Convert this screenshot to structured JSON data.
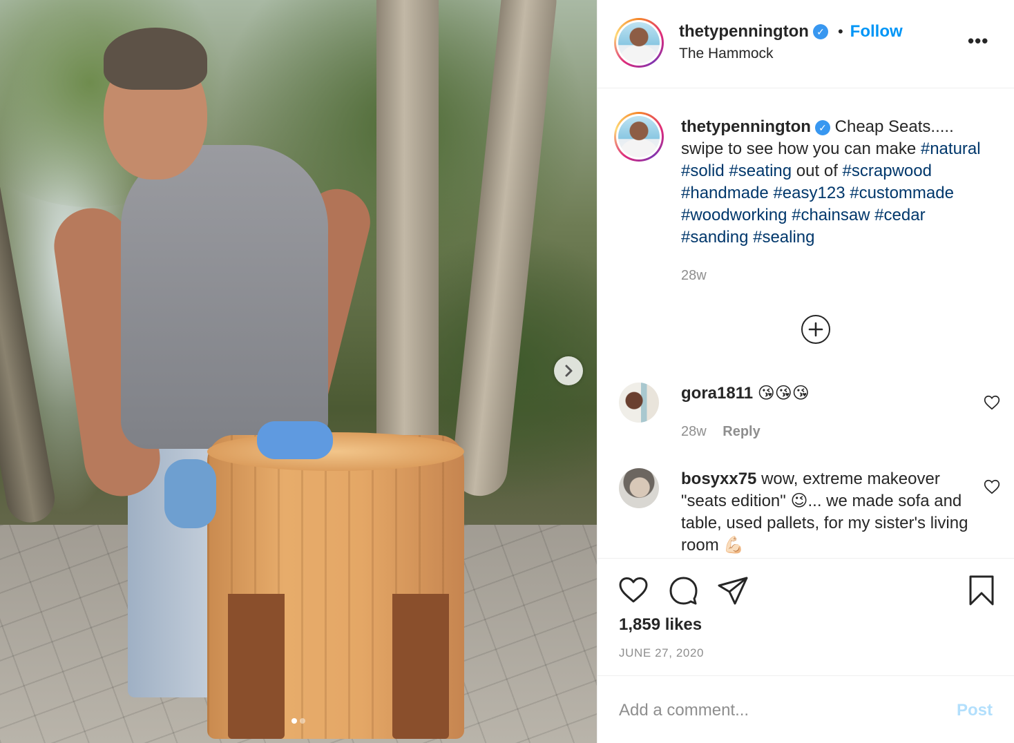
{
  "post": {
    "image_alt": "Man in gray tank top and blue gloves leaning on a handmade cedar stool outdoors",
    "carousel": {
      "count": 2,
      "active_index": 0
    }
  },
  "header": {
    "username": "thetypennington",
    "separator": "•",
    "follow_label": "Follow",
    "location": "The Hammock"
  },
  "caption": {
    "username": "thetypennington",
    "segments": [
      {
        "text": "Cheap Seats..... swipe to see how you can make ",
        "tag": false
      },
      {
        "text": "#natural",
        "tag": true
      },
      {
        "text": " ",
        "tag": false
      },
      {
        "text": "#solid",
        "tag": true
      },
      {
        "text": " ",
        "tag": false
      },
      {
        "text": "#seating",
        "tag": true
      },
      {
        "text": " out of ",
        "tag": false
      },
      {
        "text": "#scrapwood",
        "tag": true
      },
      {
        "text": " ",
        "tag": false
      },
      {
        "text": "#handmade",
        "tag": true
      },
      {
        "text": " ",
        "tag": false
      },
      {
        "text": "#easy123",
        "tag": true
      },
      {
        "text": " ",
        "tag": false
      },
      {
        "text": "#custommade",
        "tag": true
      },
      {
        "text": " ",
        "tag": false
      },
      {
        "text": "#woodworking",
        "tag": true
      },
      {
        "text": " ",
        "tag": false
      },
      {
        "text": "#chainsaw",
        "tag": true
      },
      {
        "text": " ",
        "tag": false
      },
      {
        "text": "#cedar",
        "tag": true
      },
      {
        "text": " ",
        "tag": false
      },
      {
        "text": "#sanding",
        "tag": true
      },
      {
        "text": " ",
        "tag": false
      },
      {
        "text": "#sealing",
        "tag": true
      }
    ],
    "time": "28w"
  },
  "comments": [
    {
      "username": "gora1811",
      "text": "😘😘😘",
      "time": "28w",
      "reply_label": "Reply"
    },
    {
      "username": "bosyxx75",
      "text": "wow, extreme makeover \"seats edition\" 😉... we made sofa and table, used pallets, for my sister's living room 💪🏻"
    }
  ],
  "actions": {
    "likes": "1,859 likes",
    "date": "JUNE 27, 2020"
  },
  "add_comment": {
    "placeholder": "Add a comment...",
    "post_label": "Post"
  },
  "colors": {
    "link_blue": "#0095f6",
    "hashtag": "#00376b",
    "muted": "#8e8e8e",
    "verified": "#3897f0"
  }
}
